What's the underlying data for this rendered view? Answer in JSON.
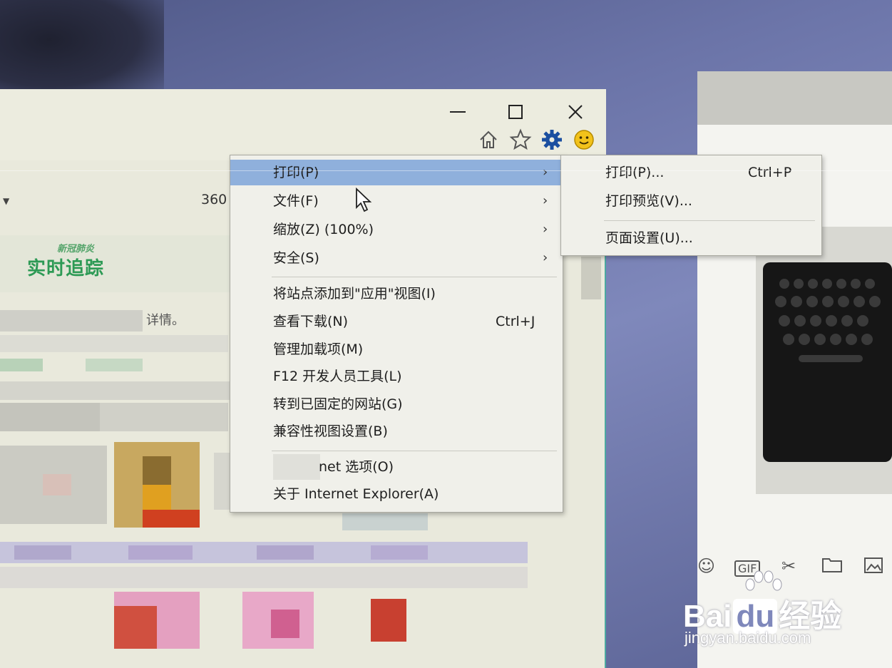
{
  "window": {
    "minimize_glyph": "—",
    "maximize_glyph": "☐",
    "close_glyph": "✕"
  },
  "toolbar": {
    "icons": [
      "home-icon",
      "favorites-star-icon",
      "tools-gear-icon",
      "feedback-smiley-icon"
    ]
  },
  "address": {
    "caret": "▼",
    "text": "360"
  },
  "page": {
    "banner_small": "新冠肺炎",
    "banner_big": "实时追踪",
    "snippet": "详情。"
  },
  "tools_menu": {
    "items": [
      {
        "label": "打印(P)",
        "shortcut": "",
        "arrow": "›"
      },
      {
        "label": "文件(F)",
        "shortcut": "",
        "arrow": "›"
      },
      {
        "label": "缩放(Z) (100%)",
        "shortcut": "",
        "arrow": "›"
      },
      {
        "label": "安全(S)",
        "shortcut": "",
        "arrow": "›"
      },
      {
        "label": "将站点添加到\"应用\"视图(I)",
        "shortcut": "",
        "arrow": ""
      },
      {
        "label": "查看下载(N)",
        "shortcut": "Ctrl+J",
        "arrow": ""
      },
      {
        "label": "管理加载项(M)",
        "shortcut": "",
        "arrow": ""
      },
      {
        "label": "F12 开发人员工具(L)",
        "shortcut": "",
        "arrow": ""
      },
      {
        "label": "转到已固定的网站(G)",
        "shortcut": "",
        "arrow": ""
      },
      {
        "label": "兼容性视图设置(B)",
        "shortcut": "",
        "arrow": ""
      },
      {
        "label": "net 选项(O)",
        "shortcut": "",
        "arrow": ""
      },
      {
        "label": "关于 Internet Explorer(A)",
        "shortcut": "",
        "arrow": ""
      }
    ]
  },
  "print_submenu": {
    "items": [
      {
        "label": "打印(P)...",
        "shortcut": "Ctrl+P"
      },
      {
        "label": "打印预览(V)...",
        "shortcut": ""
      },
      {
        "label": "页面设置(U)...",
        "shortcut": ""
      }
    ]
  },
  "side_toolbar": {
    "icons": [
      "emoji-icon",
      "gif-icon",
      "scissors-icon",
      "folder-icon",
      "image-icon"
    ]
  },
  "watermark": {
    "brand": "Bai",
    "brand_tail": "du",
    "brand_cn": "经验",
    "url": "jingyan.baidu.com"
  },
  "colors": {
    "menu_bg": "#f0f0ea",
    "highlight": "#8fb0dc",
    "banner_green": "#2d9a55",
    "desktop": "#6b74a8"
  }
}
